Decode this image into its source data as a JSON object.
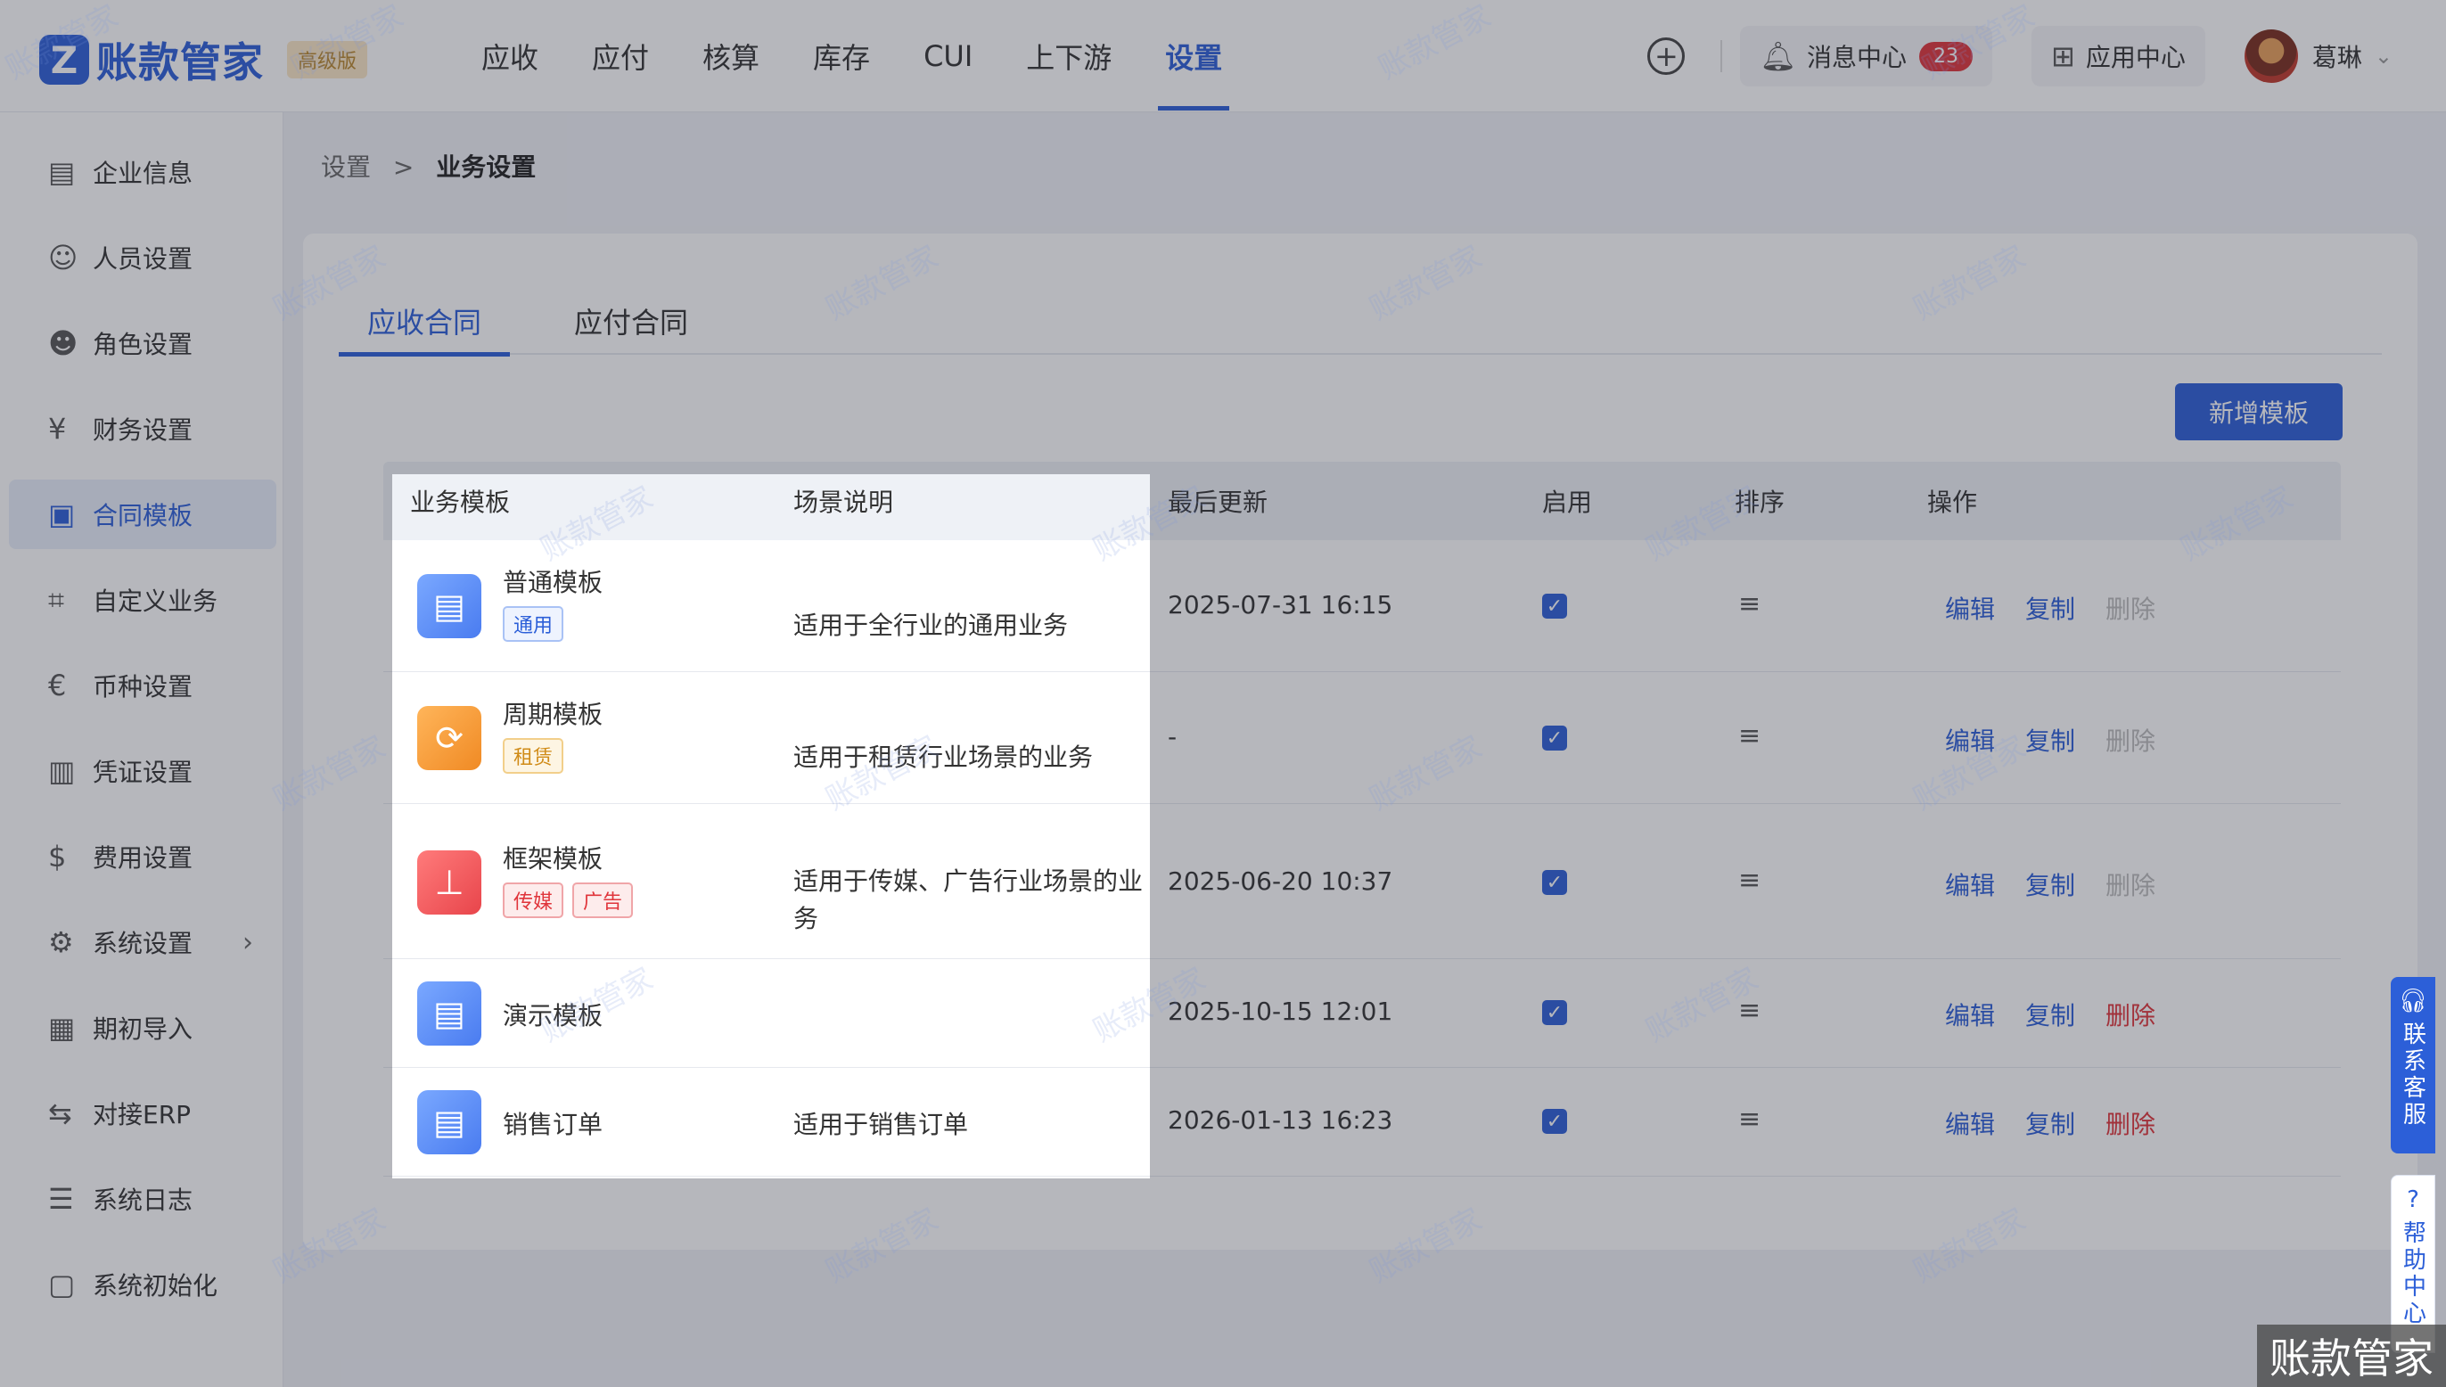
{
  "header": {
    "logo_mark": "Z",
    "logo_text": "账款管家",
    "edition_badge": "高级版",
    "nav": [
      "应收",
      "应付",
      "核算",
      "库存",
      "CUI",
      "上下游",
      "设置"
    ],
    "active_nav": "设置",
    "messages_label": "消息中心",
    "messages_count": "23",
    "apps_label": "应用中心",
    "user_name": "葛琳"
  },
  "sidebar": {
    "items": [
      {
        "label": "企业信息",
        "icon": "building-icon"
      },
      {
        "label": "人员设置",
        "icon": "users-icon"
      },
      {
        "label": "角色设置",
        "icon": "role-icon"
      },
      {
        "label": "财务设置",
        "icon": "finance-icon"
      },
      {
        "label": "合同模板",
        "icon": "briefcase-icon",
        "active": true
      },
      {
        "label": "自定义业务",
        "icon": "custom-icon"
      },
      {
        "label": "币种设置",
        "icon": "currency-icon"
      },
      {
        "label": "凭证设置",
        "icon": "voucher-icon"
      },
      {
        "label": "费用设置",
        "icon": "expense-icon"
      },
      {
        "label": "系统设置",
        "icon": "system-gear-icon",
        "has_arrow": true
      },
      {
        "label": "期初导入",
        "icon": "import-icon"
      },
      {
        "label": "对接ERP",
        "icon": "erp-icon"
      },
      {
        "label": "系统日志",
        "icon": "log-icon"
      },
      {
        "label": "系统初始化",
        "icon": "init-icon"
      }
    ]
  },
  "breadcrumb": {
    "parent": "设置",
    "separator": ">",
    "current": "业务设置"
  },
  "tabs": [
    "应收合同",
    "应付合同"
  ],
  "active_tab": "应收合同",
  "add_button": "新增模板",
  "table": {
    "columns": [
      "业务模板",
      "场景说明",
      "最后更新",
      "启用",
      "排序",
      "操作"
    ],
    "rows": [
      {
        "name": "普通模板",
        "tags": [
          "通用"
        ],
        "desc": "适用于全行业的通用业务",
        "updated": "2025-07-31 16:15",
        "enabled": true,
        "delete_enabled": false
      },
      {
        "name": "周期模板",
        "tags": [
          "租赁"
        ],
        "desc": "适用于租赁行业场景的业务",
        "updated": "-",
        "enabled": true,
        "delete_enabled": false
      },
      {
        "name": "框架模板",
        "tags": [
          "传媒",
          "广告"
        ],
        "desc": "适用于传媒、广告行业场景的业务",
        "updated": "2025-06-20 10:37",
        "enabled": true,
        "delete_enabled": false
      },
      {
        "name": "演示模板",
        "tags": [],
        "desc": "",
        "updated": "2025-10-15 12:01",
        "enabled": true,
        "delete_enabled": true
      },
      {
        "name": "销售订单",
        "tags": [],
        "desc": "适用于销售订单",
        "updated": "2026-01-13 16:23",
        "enabled": true,
        "delete_enabled": true
      }
    ],
    "actions": {
      "edit": "编辑",
      "copy": "复制",
      "delete": "删除"
    }
  },
  "float": {
    "contact": "联系客服",
    "help": "帮助中心"
  },
  "watermark": "账款管家",
  "colors": {
    "accent": "#2c5fd8",
    "danger": "#e0353b"
  }
}
